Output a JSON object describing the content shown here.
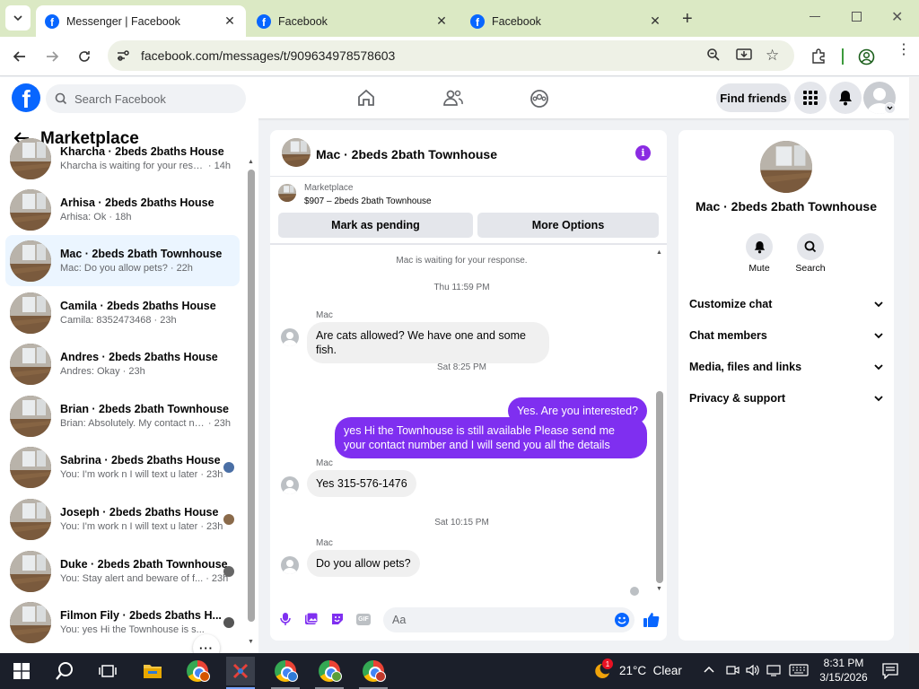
{
  "browser": {
    "tabs": [
      {
        "title": "Messenger | Facebook",
        "active": true
      },
      {
        "title": "Facebook",
        "active": false
      },
      {
        "title": "Facebook",
        "active": false
      }
    ],
    "url": "facebook.com/messages/t/909634978578603"
  },
  "header": {
    "search_placeholder": "Search Facebook",
    "find_friends_label": "Find friends"
  },
  "sidebar": {
    "title": "Marketplace",
    "conversations": [
      {
        "title": "Kharcha · 2beds 2baths House",
        "preview": "Kharcha is waiting for your respo...",
        "time": "· 14h"
      },
      {
        "title": "Arhisa · 2beds 2baths House",
        "preview": "Arhisa: Ok",
        "time": "· 18h"
      },
      {
        "title": "Mac · 2beds 2bath Townhouse",
        "preview": "Mac: Do you allow pets?",
        "time": "· 22h",
        "selected": true
      },
      {
        "title": "Camila · 2beds 2baths House",
        "preview": "Camila: 8352473468",
        "time": "· 23h"
      },
      {
        "title": "Andres · 2beds 2baths House",
        "preview": "Andres: Okay",
        "time": "· 23h"
      },
      {
        "title": "Brian · 2beds 2bath Townhouse",
        "preview": "Brian: Absolutely. My contact nu...",
        "time": "· 23h"
      },
      {
        "title": "Sabrina · 2beds 2baths House",
        "preview": "You: I'm work n I will text u later",
        "time": "· 23h"
      },
      {
        "title": "Joseph · 2beds 2baths House",
        "preview": "You: I'm work n I will text u later",
        "time": "· 23h"
      },
      {
        "title": "Duke · 2beds 2bath Townhouse",
        "preview": "You: Stay alert and beware of f...",
        "time": "· 23h"
      },
      {
        "title": "Filmon Fily · 2beds 2baths H...",
        "preview": "You: yes Hi the Townhouse is s...",
        "time": ""
      }
    ]
  },
  "chat": {
    "title": "Mac · 2beds 2bath Townhouse",
    "listing_label": "Marketplace",
    "listing_detail": "$907 – 2beds 2bath Townhouse",
    "mark_pending_label": "Mark as pending",
    "more_options_label": "More Options",
    "waiting_text": "Mac is waiting for your response.",
    "messages": [
      {
        "type": "timestamp",
        "text": "Thu 11:59 PM"
      },
      {
        "type": "in",
        "sender": "Mac",
        "text": "Are cats allowed? We have one and some fish."
      },
      {
        "type": "timestamp",
        "text": "Sat 8:25 PM"
      },
      {
        "type": "out",
        "text": "Yes. Are you interested?"
      },
      {
        "type": "out",
        "text": "yes Hi the Townhouse is still available Please send me your contact number and I will send you all the details"
      },
      {
        "type": "in",
        "sender": "Mac",
        "text": "Yes 315-576-1476"
      },
      {
        "type": "timestamp",
        "text": "Sat 10:15 PM"
      },
      {
        "type": "in",
        "sender": "Mac",
        "text": "Do you allow pets?"
      }
    ],
    "composer_placeholder": "Aa",
    "gif_label": "GIF",
    "accent_color": "#7f2ff0"
  },
  "info": {
    "title": "Mac · 2beds 2bath Townhouse",
    "mute_label": "Mute",
    "search_label": "Search",
    "sections": [
      "Customize chat",
      "Chat members",
      "Media, files and links",
      "Privacy & support"
    ]
  },
  "taskbar": {
    "weather": "21°C  Clear",
    "weather_badge": "1",
    "time": "8:31 PM",
    "date": "3/15/2026"
  }
}
